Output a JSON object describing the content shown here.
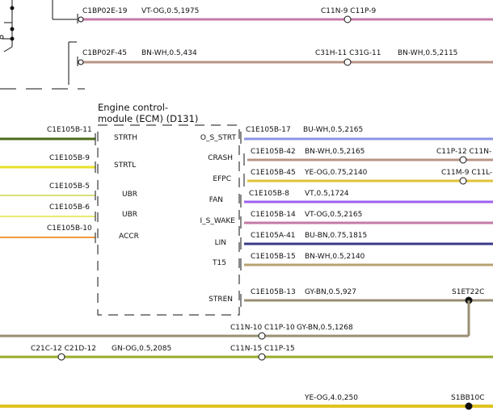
{
  "colors": {
    "violet_orange": "#c47aa5",
    "brown_white": "#b89486",
    "yellow_orange": "#e2c23a",
    "blue_white": "#8c94e6",
    "violet": "#9e5ff0",
    "violet_orange2": "#c47aa5",
    "blue_brown": "#3a3a88",
    "grey_brown": "#9a8f74",
    "green_orange": "#9aaa2a",
    "green_dark": "#4d6b1a",
    "yellow": "#e8e02e",
    "yellow_light": "#e8ec6a",
    "orange": "#f19a3a",
    "brown_green": "#b8a070",
    "yellow_thick": "#e0c420"
  },
  "ecm": {
    "title_line1": "Engine control-",
    "title_line2": "module (ECM) (D131)",
    "left_pins": [
      "STRTH",
      "STRTL",
      "UBR",
      "UBR",
      "ACCR"
    ],
    "right_pins": [
      "O_S_STRT",
      "CRASH",
      "EFPC",
      "FAN",
      "I_S_WAKE",
      "LIN",
      "T15",
      "STREN"
    ]
  },
  "left_wires": [
    {
      "connector": "C1E105B-11"
    },
    {
      "connector": "C1E105B-9"
    },
    {
      "connector": "C1E105B-5"
    },
    {
      "connector": "C1E105B-6"
    },
    {
      "connector": "C1E105B-10"
    }
  ],
  "right_wires": [
    {
      "connector": "C1E105B-17",
      "spec": "BU-WH,0.5,2165",
      "far": ""
    },
    {
      "connector": "C1E105B-42",
      "spec": "BN-WH,0.5,2165",
      "far": "C11P-12 C11N-"
    },
    {
      "connector": "C1E105B-45",
      "spec": "YE-OG,0.75,2140",
      "far": "C11M-9 C11L-"
    },
    {
      "connector": "C1E105B-8",
      "spec": "VT,0.5,1724",
      "far": ""
    },
    {
      "connector": "C1E105B-14",
      "spec": "VT-OG,0.5,2165",
      "far": ""
    },
    {
      "connector": "C1E105A-41",
      "spec": "BU-BN,0.75,1815",
      "far": ""
    },
    {
      "connector": "C1E105B-15",
      "spec": "BN-WH,0.5,2140",
      "far": ""
    },
    {
      "connector": "C1E105B-13",
      "spec": "GY-BN,0.5,927",
      "far": "S1ET22C"
    }
  ],
  "top_wires": [
    {
      "connector": "C1BP02E-19",
      "spec": "VT-OG,0.5,1975",
      "mid": "C11N-9 C11P-9",
      "spec2": ""
    },
    {
      "connector": "C1BP02F-45",
      "spec": "BN-WH,0.5,434",
      "mid": "C31H-11 C31G-11",
      "spec2": "BN-WH,0.5,2115"
    }
  ],
  "bottom_wires": [
    {
      "left": "",
      "mid": "C11N-10 C11P-10",
      "spec": "GY-BN,0.5,1268"
    },
    {
      "left": "C21C-12 C21D-12",
      "spec_left": "GN-OG,0.5,2085",
      "mid": "C11N-15 C11P-15"
    },
    {
      "spec": "YE-OG,4.0,250",
      "right": "S1BB10C"
    }
  ]
}
